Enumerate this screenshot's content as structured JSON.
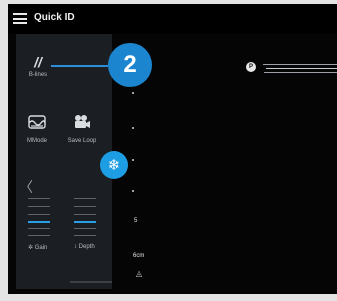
{
  "topbar": {
    "title": "Quick ID"
  },
  "tools": {
    "blines": {
      "glyph": "//",
      "label": "B-lines"
    },
    "mmode": {
      "label": "MMode"
    },
    "save_loop": {
      "label": "Save Loop"
    }
  },
  "sliders": {
    "gain": {
      "icon": "✲",
      "label": "Gain"
    },
    "depth": {
      "icon": "↕",
      "label": "Depth"
    }
  },
  "freeze": {
    "icon": "snowflake-icon",
    "glyph": "❄"
  },
  "callout": {
    "number": "2"
  },
  "image": {
    "marker": "P",
    "depth_labels": {
      "mid": "5",
      "bottom": "6cm"
    }
  },
  "colors": {
    "accent": "#1d9de3",
    "panel": "#1b1f23",
    "screen": "#050505"
  }
}
